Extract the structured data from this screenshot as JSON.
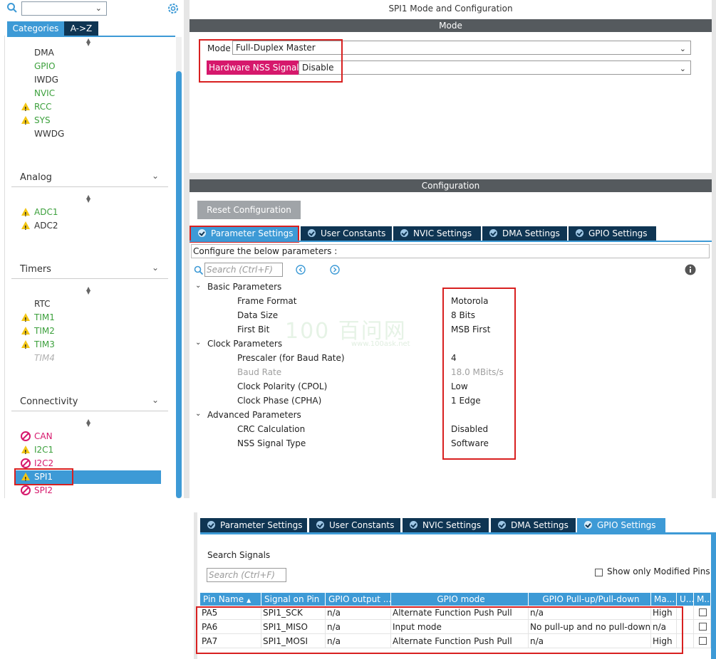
{
  "left": {
    "tabs": [
      "Categories",
      "A->Z"
    ],
    "system_items": [
      {
        "label": "DMA",
        "color": "dark",
        "icon": ""
      },
      {
        "label": "GPIO",
        "color": "green",
        "icon": ""
      },
      {
        "label": "IWDG",
        "color": "dark",
        "icon": ""
      },
      {
        "label": "NVIC",
        "color": "green",
        "icon": ""
      },
      {
        "label": "RCC",
        "color": "green",
        "icon": "warning-icon"
      },
      {
        "label": "SYS",
        "color": "green",
        "icon": "warning-icon"
      },
      {
        "label": "WWDG",
        "color": "dark",
        "icon": ""
      }
    ],
    "analog": {
      "title": "Analog",
      "items": [
        {
          "label": "ADC1",
          "color": "green",
          "icon": "warning-icon"
        },
        {
          "label": "ADC2",
          "color": "dark",
          "icon": "warning-icon"
        }
      ]
    },
    "timers": {
      "title": "Timers",
      "items": [
        {
          "label": "RTC",
          "color": "dark",
          "icon": ""
        },
        {
          "label": "TIM1",
          "color": "green",
          "icon": "warning-icon"
        },
        {
          "label": "TIM2",
          "color": "green",
          "icon": "warning-icon"
        },
        {
          "label": "TIM3",
          "color": "green",
          "icon": "warning-icon"
        },
        {
          "label": "TIM4",
          "color": "grey",
          "icon": ""
        }
      ]
    },
    "connectivity": {
      "title": "Connectivity",
      "items": [
        {
          "label": "CAN",
          "color": "pink",
          "icon": "ban-icon"
        },
        {
          "label": "I2C1",
          "color": "green",
          "icon": "warning-icon"
        },
        {
          "label": "I2C2",
          "color": "pink",
          "icon": "ban-icon"
        },
        {
          "label": "SPI1",
          "color": "white",
          "icon": "warning-icon"
        },
        {
          "label": "SPI2",
          "color": "pink",
          "icon": "ban-icon"
        }
      ]
    }
  },
  "main": {
    "window_title": "SPI1 Mode and Configuration",
    "mode_header": "Mode",
    "mode_label": "Mode",
    "mode_value": "Full-Duplex Master",
    "nss_label": "Hardware NSS Signal",
    "nss_value": "Disable",
    "config_header": "Configuration",
    "reset_button": "Reset Configuration",
    "tabs": [
      "Parameter Settings",
      "User Constants",
      "NVIC Settings",
      "DMA Settings",
      "GPIO Settings"
    ],
    "configure_text": "Configure the below parameters :",
    "search_placeholder": "Search (Ctrl+F)",
    "watermark": "100 百问网",
    "watermark_url": "www.100ask.net",
    "groups": [
      {
        "title": "Basic Parameters",
        "params": [
          {
            "label": "Frame Format",
            "value": "Motorola",
            "disabled": false
          },
          {
            "label": "Data Size",
            "value": "8 Bits",
            "disabled": false
          },
          {
            "label": "First Bit",
            "value": "MSB First",
            "disabled": false
          }
        ]
      },
      {
        "title": "Clock Parameters",
        "params": [
          {
            "label": "Prescaler (for Baud Rate)",
            "value": "4",
            "disabled": false
          },
          {
            "label": "Baud Rate",
            "value": "18.0 MBits/s",
            "disabled": true
          },
          {
            "label": "Clock Polarity (CPOL)",
            "value": "Low",
            "disabled": false
          },
          {
            "label": "Clock Phase (CPHA)",
            "value": "1 Edge",
            "disabled": false
          }
        ]
      },
      {
        "title": "Advanced Parameters",
        "params": [
          {
            "label": "CRC Calculation",
            "value": "Disabled",
            "disabled": false
          },
          {
            "label": "NSS Signal Type",
            "value": "Software",
            "disabled": false
          }
        ]
      }
    ]
  },
  "gpio": {
    "tabs": [
      "Parameter Settings",
      "User Constants",
      "NVIC Settings",
      "DMA Settings",
      "GPIO Settings"
    ],
    "search_signals": "Search Signals",
    "search_placeholder": "Search (Ctrl+F)",
    "show_modified": "Show only Modified Pins",
    "columns": [
      "Pin Name",
      "Signal on Pin",
      "GPIO output ...",
      "GPIO mode",
      "GPIO Pull-up/Pull-down",
      "Ma...",
      "U...",
      "M..."
    ],
    "rows": [
      [
        "PA5",
        "SPI1_SCK",
        "n/a",
        "Alternate Function Push Pull",
        "n/a",
        "High",
        "",
        ""
      ],
      [
        "PA6",
        "SPI1_MISO",
        "n/a",
        "Input mode",
        "No pull-up and no pull-down",
        "n/a",
        "",
        ""
      ],
      [
        "PA7",
        "SPI1_MOSI",
        "n/a",
        "Alternate Function Push Pull",
        "n/a",
        "High",
        "",
        ""
      ]
    ]
  },
  "colors": {
    "accent": "#3d9ad6",
    "dark_tab": "#0f3553",
    "header_bar": "#555a5e",
    "highlight_red": "#d82020",
    "nss_label_bg": "#d6186c"
  }
}
